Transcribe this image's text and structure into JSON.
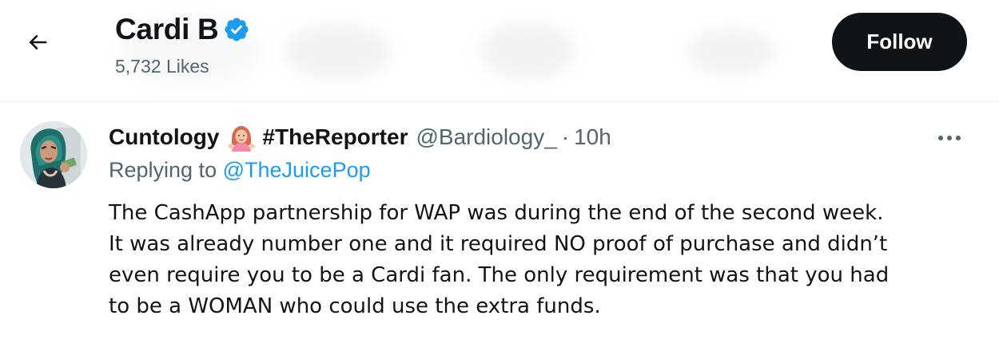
{
  "header": {
    "title": "Cardi B",
    "likes": "5,732 Likes",
    "follow_label": "Follow",
    "back_icon": "arrow-left-icon",
    "verified_icon": "verified-badge-icon",
    "verified_color": "#1d9bf0"
  },
  "tweet": {
    "author_name": "Cuntology",
    "author_emoji": "woman-shrugging-emoji",
    "author_tag": "#TheReporter",
    "handle": "@Bardiology_",
    "separator": "·",
    "time": "10h",
    "replying_prefix": "Replying to",
    "reply_to": "@TheJuicePop",
    "text_lines": [
      "The CashApp partnership for WAP was during the end of the second week.",
      "It was already number one and it required NO proof of purchase and didn’t",
      "even require you to be a Cardi fan. The only requirement was that you had",
      "to be a WOMAN who could use the extra funds."
    ],
    "more_icon": "more-horizontal-icon"
  },
  "colors": {
    "text_primary": "#0f1419",
    "text_secondary": "#536471",
    "link": "#1d9bf0",
    "button_bg": "#0f1419"
  }
}
